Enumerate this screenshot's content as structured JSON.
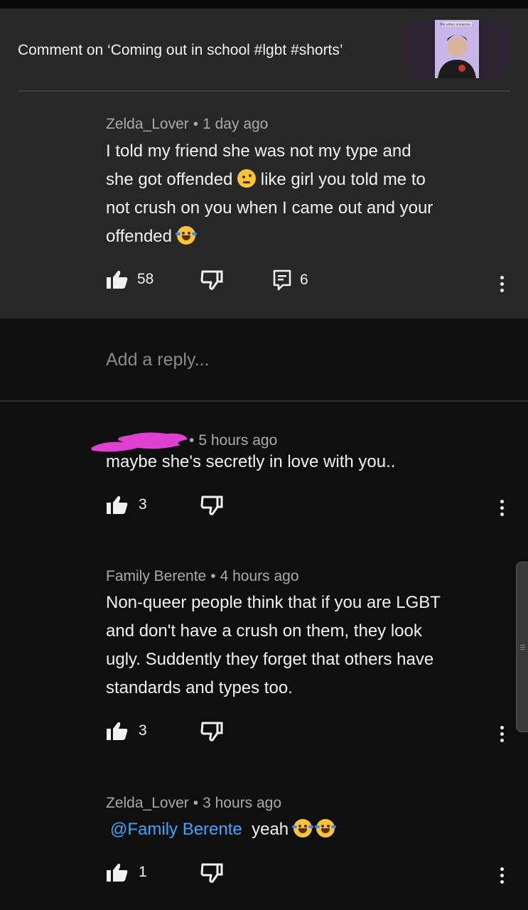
{
  "header": {
    "title": "Comment on ‘Coming out in school #lgbt #shorts’",
    "thumbnail_caption": "Me when someone..."
  },
  "parent_comment": {
    "author": "Zelda_Lover",
    "time": "1 day ago",
    "text_lines": [
      "I told my friend she was not my type and",
      "she got offended",
      "like girl you told me to",
      "not crush on you when I came out and your",
      "offended"
    ],
    "likes": "58",
    "replies_count": "6"
  },
  "reply_input": {
    "placeholder": "Add a reply..."
  },
  "replies": [
    {
      "author_redacted": true,
      "time": "5 hours ago",
      "text": "maybe she's secretly in love with you..",
      "likes": "3"
    },
    {
      "author": "Family Berente",
      "time": "4 hours ago",
      "text_lines": [
        "Non-queer people think that if you are LGBT",
        "and don't have a crush on them, they look",
        "ugly. Suddently they forget that others have",
        "standards and types too."
      ],
      "likes": "3"
    },
    {
      "author": "Zelda_Lover",
      "time": "3 hours ago",
      "mention": "@Family Berente",
      "text": "yeah",
      "likes": "1"
    }
  ],
  "colors": {
    "parent_bg": "#272727",
    "page_bg": "#0f0f0f",
    "mention": "#3ea6ff",
    "redaction": "#e040d0"
  },
  "icons": [
    "like-icon",
    "dislike-icon",
    "reply-icon",
    "more-icon",
    "emoji-raised-eyebrow",
    "emoji-rofl"
  ]
}
